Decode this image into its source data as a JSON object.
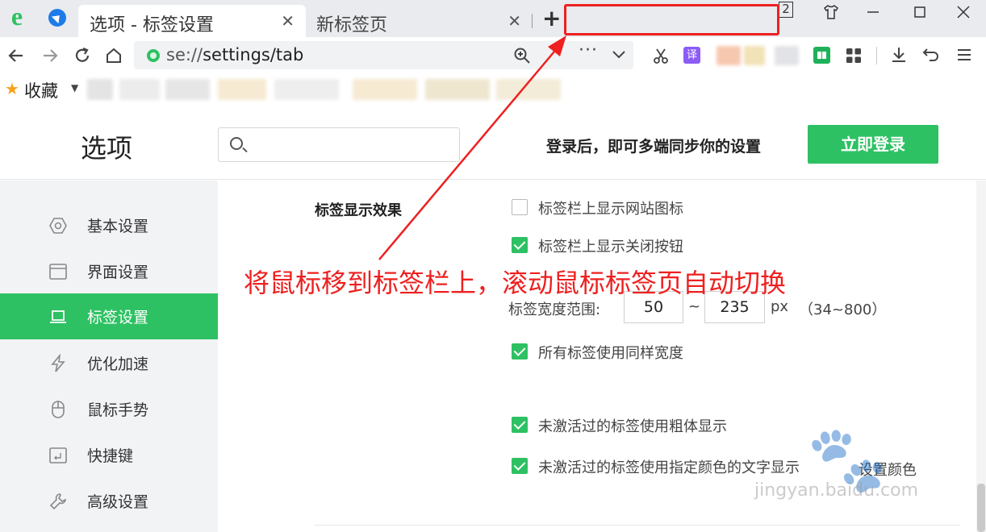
{
  "browser": {
    "tabs": [
      {
        "title": "选项 - 标签设置",
        "active": true
      },
      {
        "title": "新标签页",
        "active": false
      }
    ],
    "new_tab_label": "+",
    "window_count_badge": "2",
    "url_prefix": "se://",
    "url_rest": "settings/tab",
    "more_label": "···",
    "bookmarks_label": "收藏",
    "accent_color": "#2ec163",
    "icons": [
      "back-icon",
      "forward-icon",
      "reload-icon",
      "home-icon",
      "zoom-icon",
      "cut-icon",
      "translate-icon",
      "reader-icon",
      "apps-icon",
      "download-icon",
      "undo-icon",
      "menu-icon",
      "skin-icon",
      "minimize-icon",
      "maximize-icon",
      "close-icon"
    ]
  },
  "header": {
    "title": "选项",
    "search_placeholder": "",
    "sync_text": "登录后，即可多端同步你的设置",
    "login_button": "立即登录"
  },
  "sidebar": {
    "items": [
      {
        "label": "基本设置",
        "icon": "hexagon-icon",
        "active": false
      },
      {
        "label": "界面设置",
        "icon": "window-icon",
        "active": false
      },
      {
        "label": "标签设置",
        "icon": "laptop-icon",
        "active": true
      },
      {
        "label": "优化加速",
        "icon": "lightning-icon",
        "active": false
      },
      {
        "label": "鼠标手势",
        "icon": "mouse-icon",
        "active": false
      },
      {
        "label": "快捷键",
        "icon": "keyboard-icon",
        "active": false
      },
      {
        "label": "高级设置",
        "icon": "wrench-icon",
        "active": false
      }
    ]
  },
  "content": {
    "section_label": "标签显示效果",
    "options": [
      {
        "label": "标签栏上显示网站图标",
        "checked": false
      },
      {
        "label": "标签栏上显示关闭按钮",
        "checked": true
      },
      {
        "label": "所有标签使用同样宽度",
        "checked": true
      },
      {
        "label": "未激活过的标签使用粗体显示",
        "checked": true
      },
      {
        "label": "未激活过的标签使用指定颜色的文字显示",
        "checked": true
      }
    ],
    "width_range": {
      "label": "标签宽度范围:",
      "min": "50",
      "separator": "~",
      "max": "235",
      "unit": "px",
      "hint": "（34~800）"
    },
    "set_color_link": "设置颜色"
  },
  "annotation": {
    "text": "将鼠标移到标签栏上，滚动鼠标标签页自动切换",
    "color": "#ee2020"
  },
  "watermark": {
    "text": "jingyan.baidu.com"
  }
}
